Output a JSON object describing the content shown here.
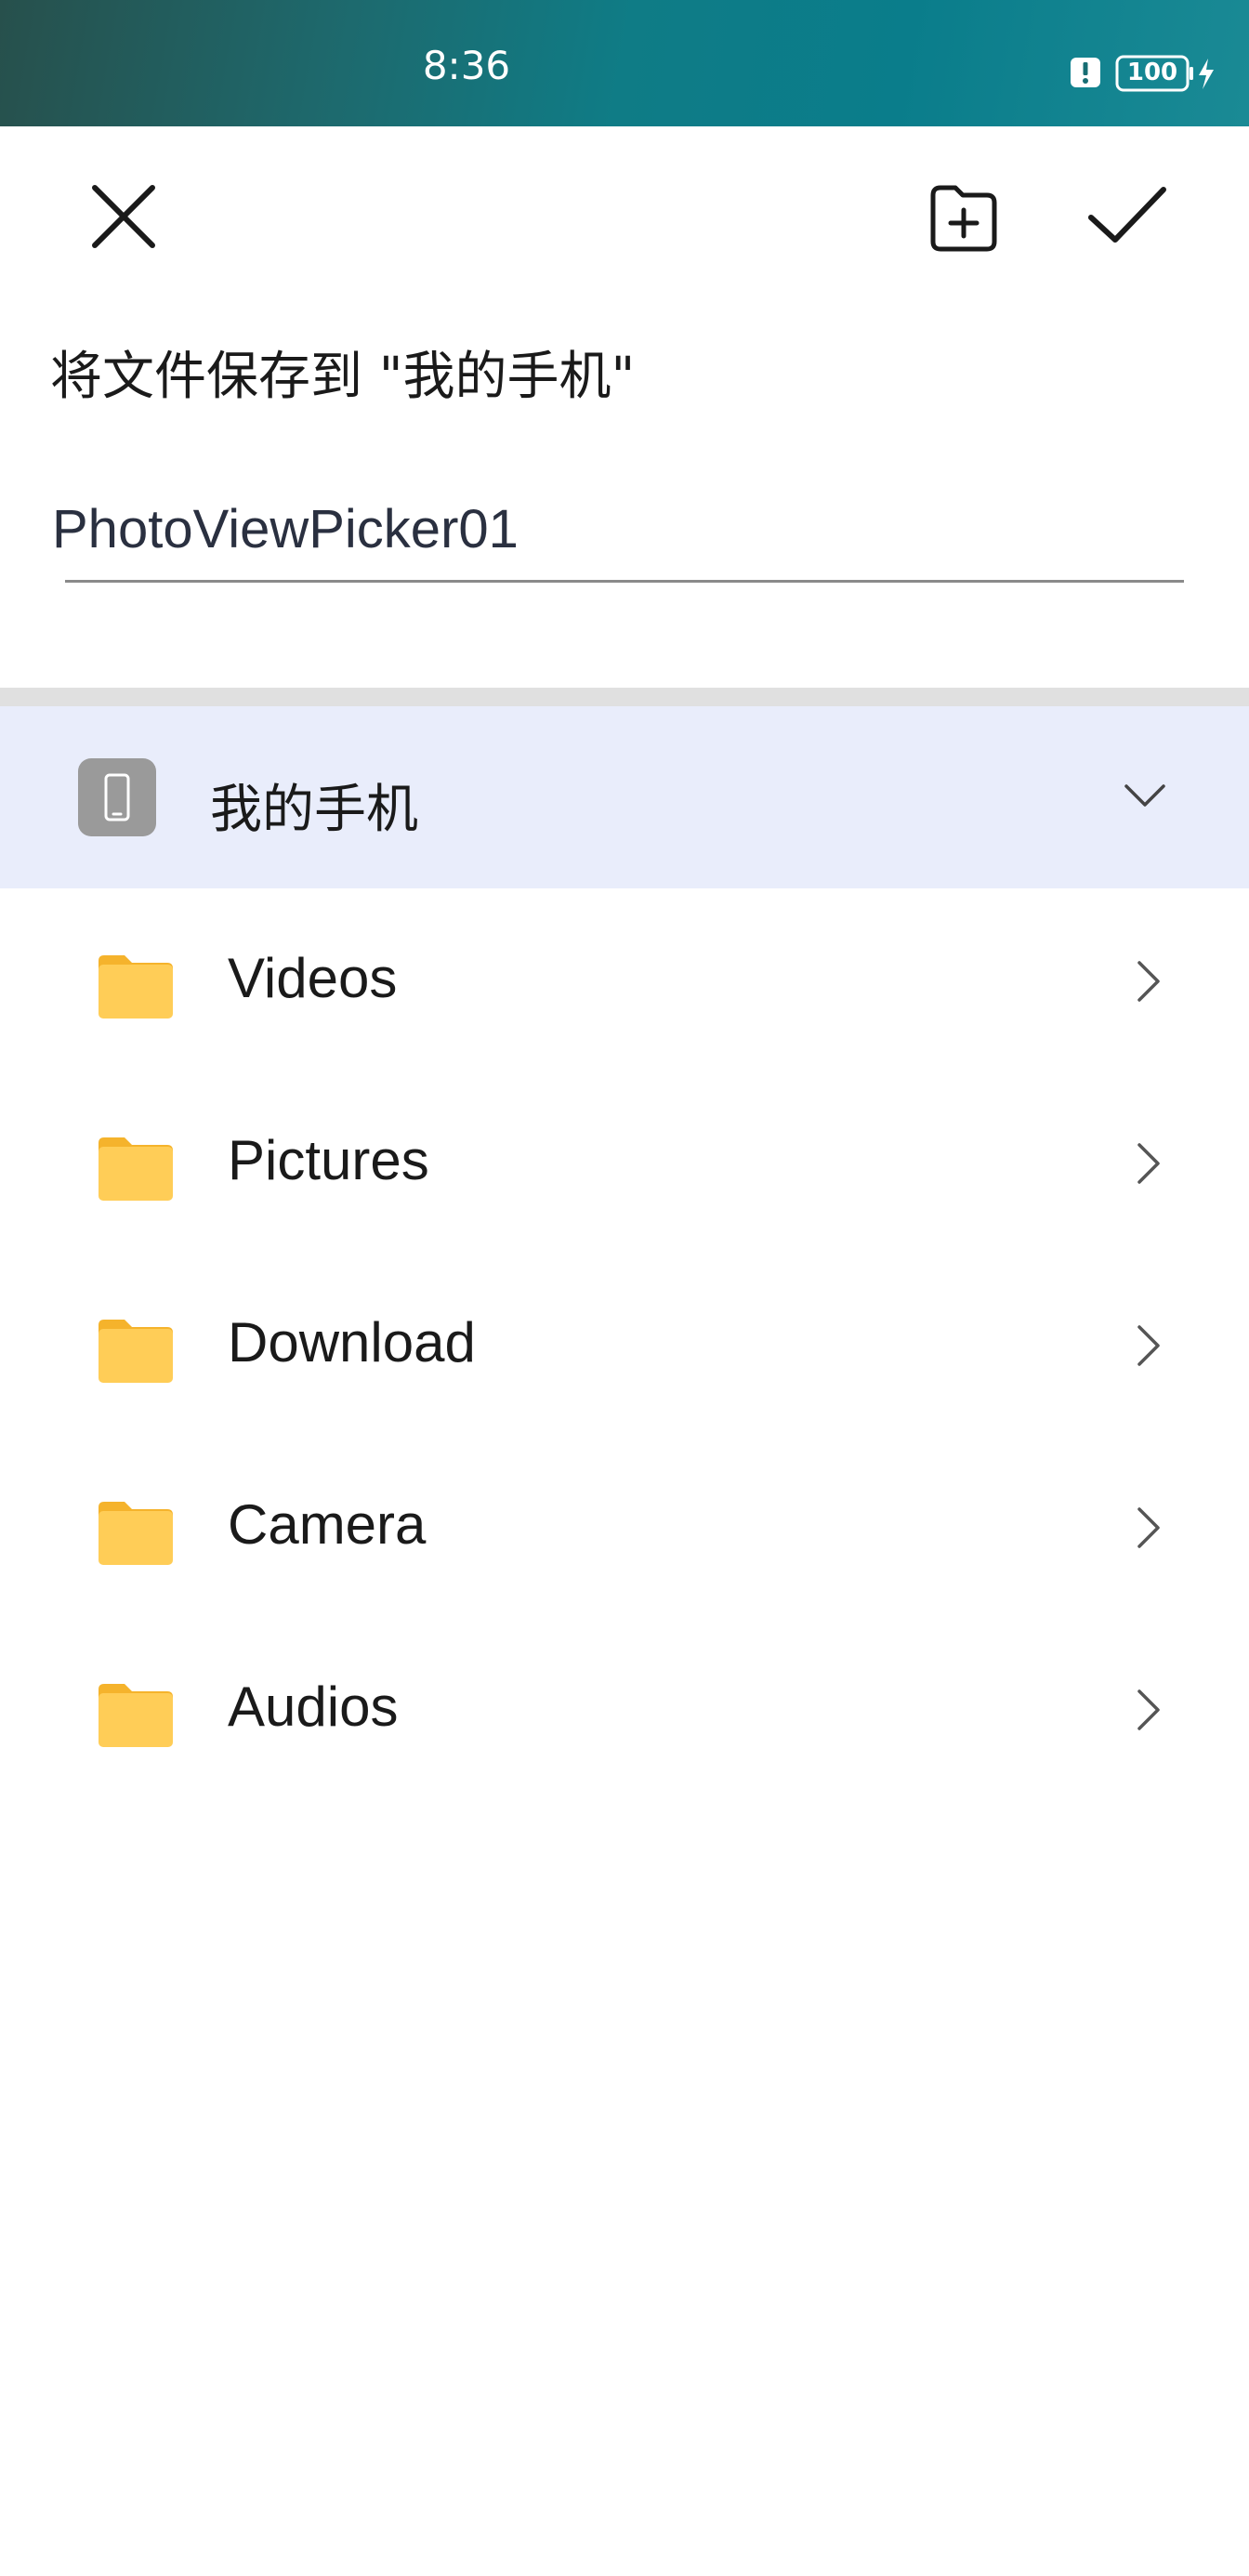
{
  "status_bar": {
    "time": "8:36",
    "battery": "100",
    "icons": [
      "alert-icon",
      "battery-icon",
      "charging-icon"
    ]
  },
  "toolbar": {
    "close_icon": "close-icon",
    "new_folder_icon": "new-folder-icon",
    "confirm_icon": "check-icon"
  },
  "dialog": {
    "title": "将文件保存到 \"我的手机\"",
    "filename_value": "PhotoViewPicker01"
  },
  "location": {
    "label": "我的手机",
    "icon": "phone-icon",
    "expanded_icon": "chevron-down-icon"
  },
  "folders": [
    {
      "label": "Videos"
    },
    {
      "label": "Pictures"
    },
    {
      "label": "Download"
    },
    {
      "label": "Camera"
    },
    {
      "label": "Audios"
    }
  ],
  "colors": {
    "selected_row": "#e9edfb",
    "folder_yellow": "#ffcd57",
    "folder_tab": "#f5b32c",
    "divider": "#e0e0e0"
  }
}
